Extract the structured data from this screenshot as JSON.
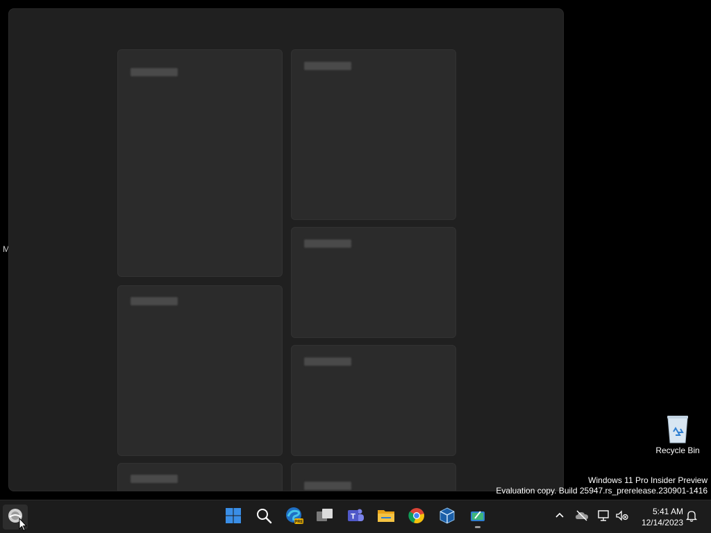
{
  "desktop": {
    "edge_fragments": [
      "M"
    ],
    "recycle_bin_label": "Recycle Bin"
  },
  "watermark": {
    "line1": "Windows 11 Pro Insider Preview",
    "line2": "Evaluation copy. Build 25947.rs_prerelease.230901-1416"
  },
  "taskbar": {
    "apps": [
      {
        "icon": "widgets-icon",
        "active": true
      },
      {
        "icon": "start-icon"
      },
      {
        "icon": "search-icon"
      },
      {
        "icon": "edge-preview-icon"
      },
      {
        "icon": "task-view-icon"
      },
      {
        "icon": "teams-icon"
      },
      {
        "icon": "file-explorer-icon"
      },
      {
        "icon": "chrome-icon"
      },
      {
        "icon": "virtualbox-icon"
      },
      {
        "icon": "snipping-tool-icon",
        "running": true
      }
    ],
    "clock": {
      "time": "5:41 AM",
      "date": "12/14/2023"
    }
  },
  "colors": {
    "desktop_bg": "#000000",
    "panel_bg": "#202020",
    "card_bg": "#2b2b2b",
    "taskbar_bg": "#1c1c1c",
    "start_blue": "#3a8ee6"
  }
}
